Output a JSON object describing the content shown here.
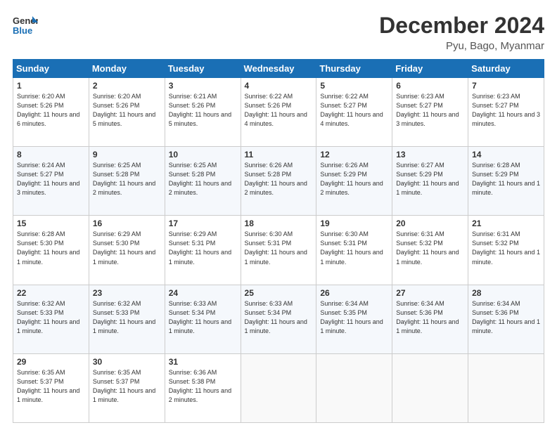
{
  "header": {
    "logo_line1": "General",
    "logo_line2": "Blue",
    "title": "December 2024",
    "subtitle": "Pyu, Bago, Myanmar"
  },
  "days_of_week": [
    "Sunday",
    "Monday",
    "Tuesday",
    "Wednesday",
    "Thursday",
    "Friday",
    "Saturday"
  ],
  "weeks": [
    [
      {
        "day": "1",
        "rise": "6:20 AM",
        "set": "5:26 PM",
        "daylight": "11 hours and 6 minutes."
      },
      {
        "day": "2",
        "rise": "6:20 AM",
        "set": "5:26 PM",
        "daylight": "11 hours and 5 minutes."
      },
      {
        "day": "3",
        "rise": "6:21 AM",
        "set": "5:26 PM",
        "daylight": "11 hours and 5 minutes."
      },
      {
        "day": "4",
        "rise": "6:22 AM",
        "set": "5:26 PM",
        "daylight": "11 hours and 4 minutes."
      },
      {
        "day": "5",
        "rise": "6:22 AM",
        "set": "5:27 PM",
        "daylight": "11 hours and 4 minutes."
      },
      {
        "day": "6",
        "rise": "6:23 AM",
        "set": "5:27 PM",
        "daylight": "11 hours and 3 minutes."
      },
      {
        "day": "7",
        "rise": "6:23 AM",
        "set": "5:27 PM",
        "daylight": "11 hours and 3 minutes."
      }
    ],
    [
      {
        "day": "8",
        "rise": "6:24 AM",
        "set": "5:27 PM",
        "daylight": "11 hours and 3 minutes."
      },
      {
        "day": "9",
        "rise": "6:25 AM",
        "set": "5:28 PM",
        "daylight": "11 hours and 2 minutes."
      },
      {
        "day": "10",
        "rise": "6:25 AM",
        "set": "5:28 PM",
        "daylight": "11 hours and 2 minutes."
      },
      {
        "day": "11",
        "rise": "6:26 AM",
        "set": "5:28 PM",
        "daylight": "11 hours and 2 minutes."
      },
      {
        "day": "12",
        "rise": "6:26 AM",
        "set": "5:29 PM",
        "daylight": "11 hours and 2 minutes."
      },
      {
        "day": "13",
        "rise": "6:27 AM",
        "set": "5:29 PM",
        "daylight": "11 hours and 1 minute."
      },
      {
        "day": "14",
        "rise": "6:28 AM",
        "set": "5:29 PM",
        "daylight": "11 hours and 1 minute."
      }
    ],
    [
      {
        "day": "15",
        "rise": "6:28 AM",
        "set": "5:30 PM",
        "daylight": "11 hours and 1 minute."
      },
      {
        "day": "16",
        "rise": "6:29 AM",
        "set": "5:30 PM",
        "daylight": "11 hours and 1 minute."
      },
      {
        "day": "17",
        "rise": "6:29 AM",
        "set": "5:31 PM",
        "daylight": "11 hours and 1 minute."
      },
      {
        "day": "18",
        "rise": "6:30 AM",
        "set": "5:31 PM",
        "daylight": "11 hours and 1 minute."
      },
      {
        "day": "19",
        "rise": "6:30 AM",
        "set": "5:31 PM",
        "daylight": "11 hours and 1 minute."
      },
      {
        "day": "20",
        "rise": "6:31 AM",
        "set": "5:32 PM",
        "daylight": "11 hours and 1 minute."
      },
      {
        "day": "21",
        "rise": "6:31 AM",
        "set": "5:32 PM",
        "daylight": "11 hours and 1 minute."
      }
    ],
    [
      {
        "day": "22",
        "rise": "6:32 AM",
        "set": "5:33 PM",
        "daylight": "11 hours and 1 minute."
      },
      {
        "day": "23",
        "rise": "6:32 AM",
        "set": "5:33 PM",
        "daylight": "11 hours and 1 minute."
      },
      {
        "day": "24",
        "rise": "6:33 AM",
        "set": "5:34 PM",
        "daylight": "11 hours and 1 minute."
      },
      {
        "day": "25",
        "rise": "6:33 AM",
        "set": "5:34 PM",
        "daylight": "11 hours and 1 minute."
      },
      {
        "day": "26",
        "rise": "6:34 AM",
        "set": "5:35 PM",
        "daylight": "11 hours and 1 minute."
      },
      {
        "day": "27",
        "rise": "6:34 AM",
        "set": "5:36 PM",
        "daylight": "11 hours and 1 minute."
      },
      {
        "day": "28",
        "rise": "6:34 AM",
        "set": "5:36 PM",
        "daylight": "11 hours and 1 minute."
      }
    ],
    [
      {
        "day": "29",
        "rise": "6:35 AM",
        "set": "5:37 PM",
        "daylight": "11 hours and 1 minute."
      },
      {
        "day": "30",
        "rise": "6:35 AM",
        "set": "5:37 PM",
        "daylight": "11 hours and 1 minute."
      },
      {
        "day": "31",
        "rise": "6:36 AM",
        "set": "5:38 PM",
        "daylight": "11 hours and 2 minutes."
      },
      null,
      null,
      null,
      null
    ]
  ]
}
